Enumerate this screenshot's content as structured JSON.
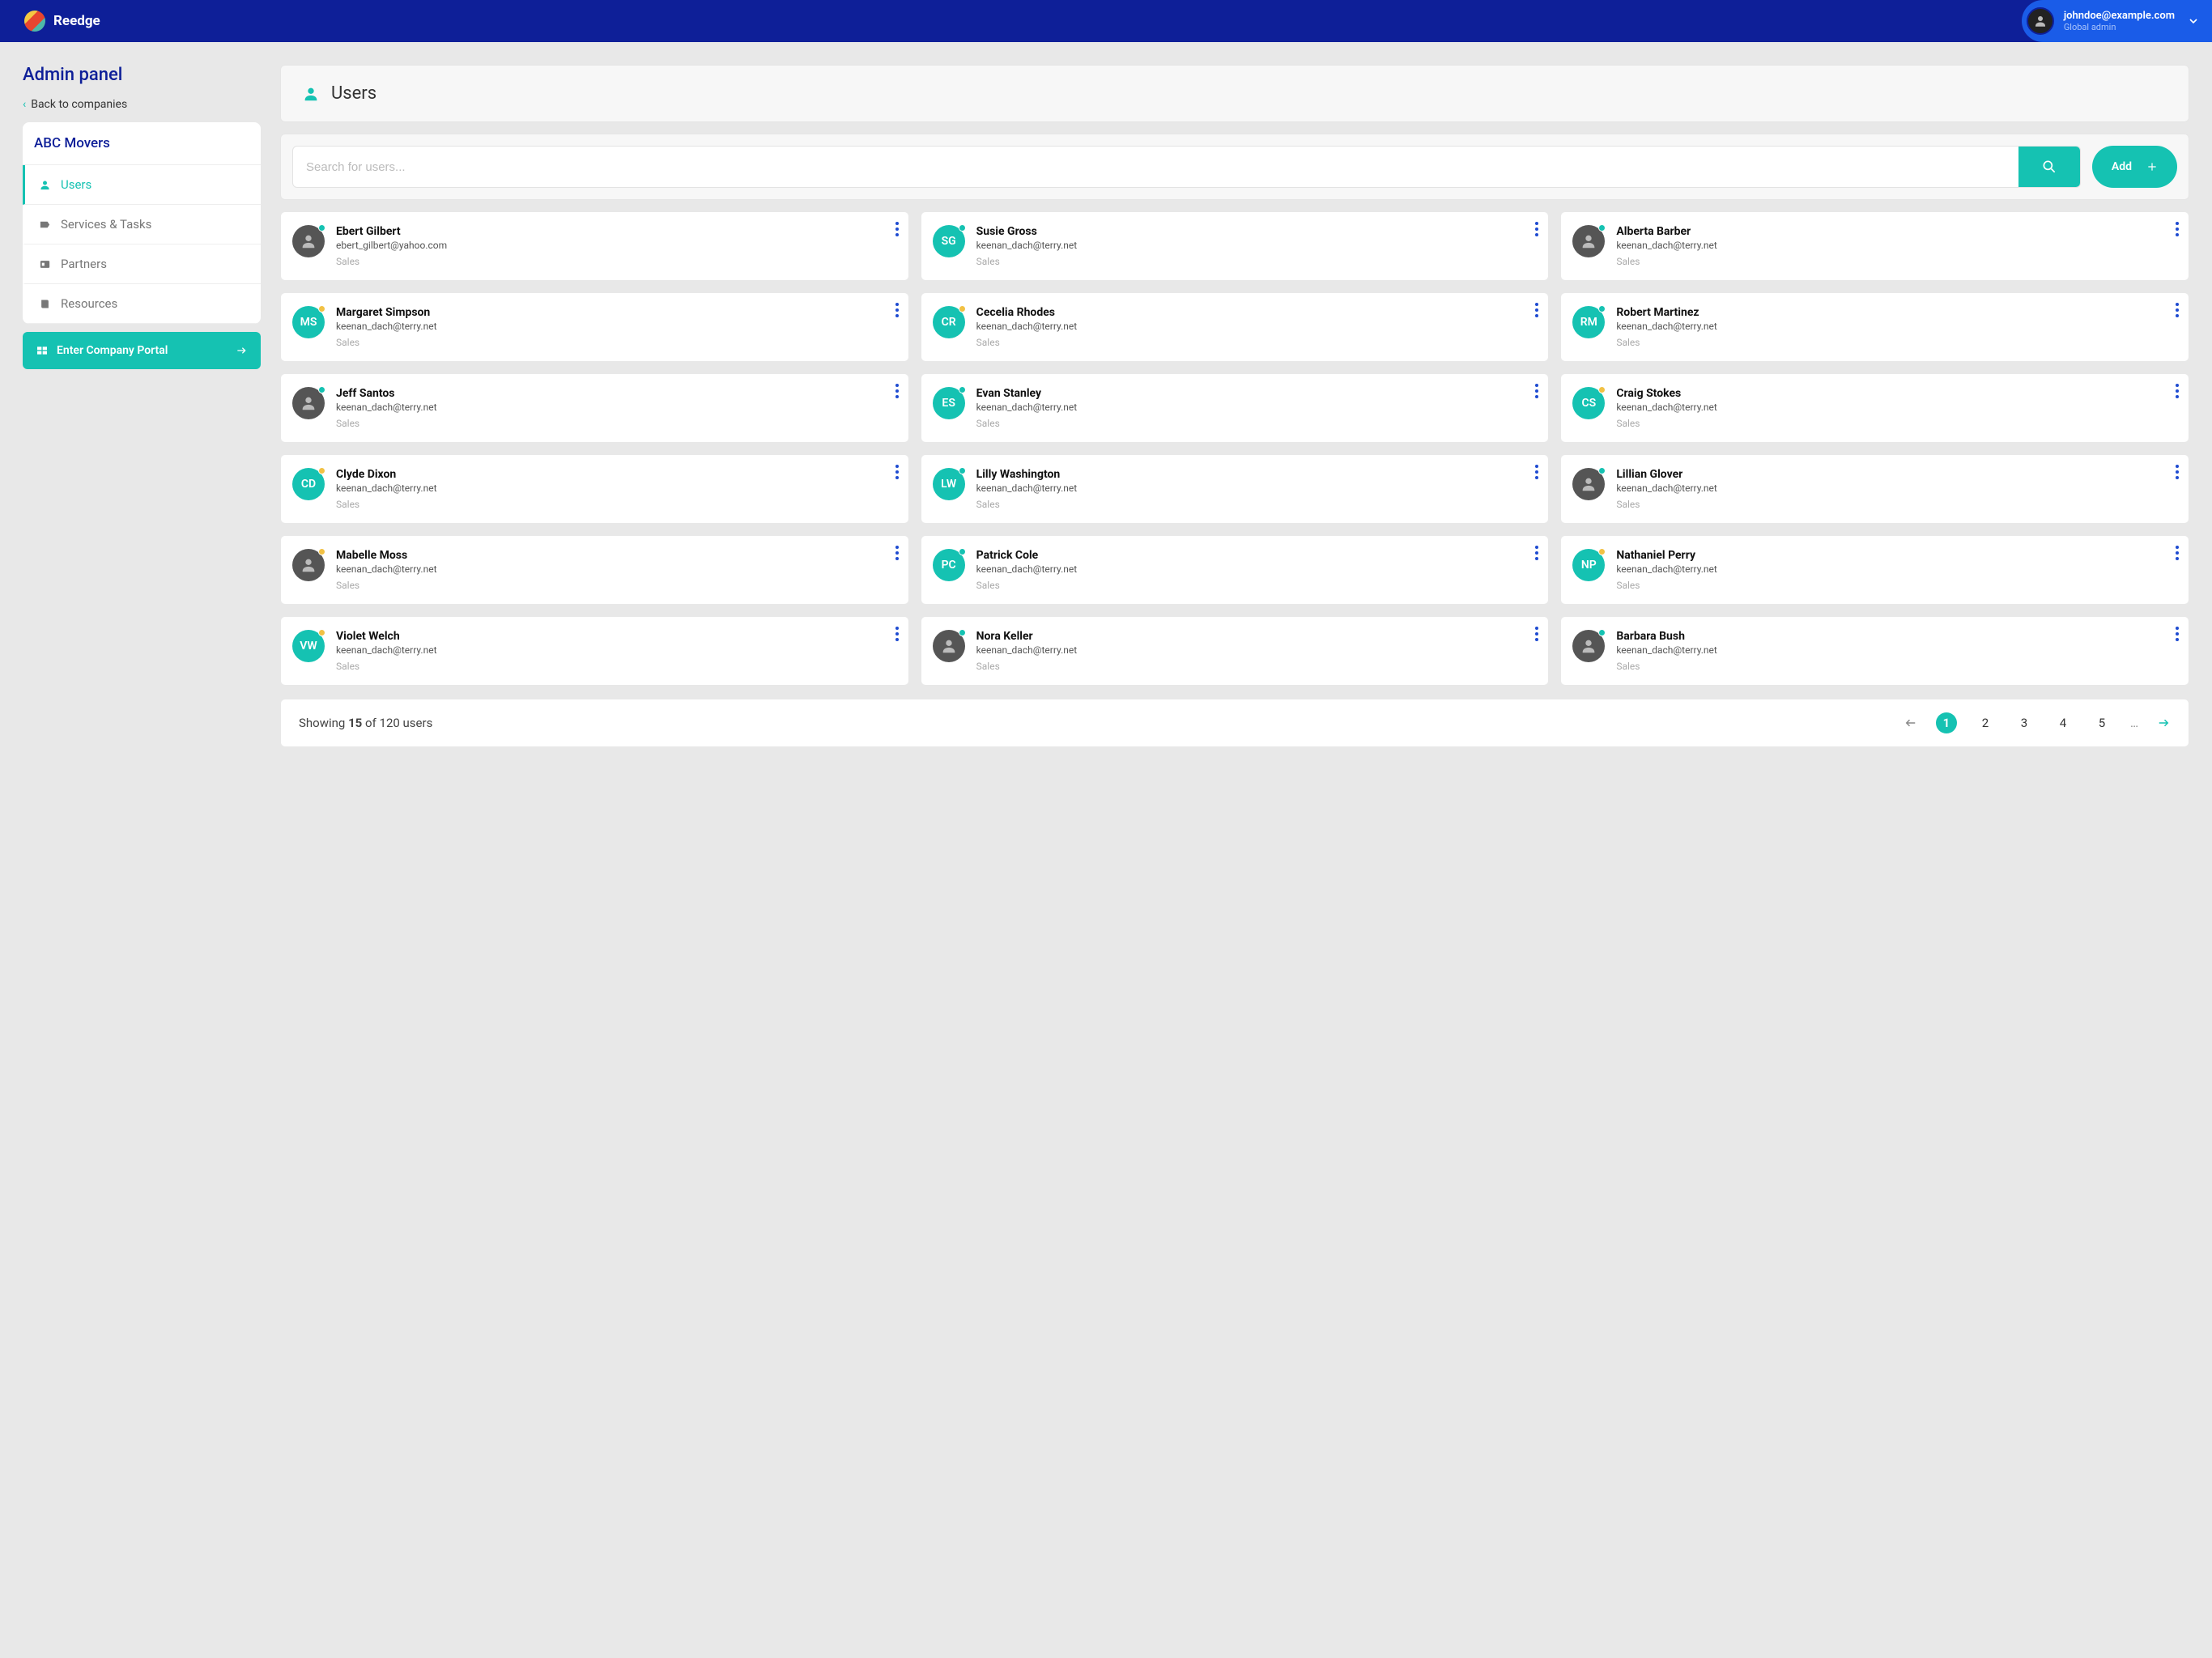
{
  "brand": "Reedge",
  "header": {
    "email": "johndoe@example.com",
    "role": "Global admin"
  },
  "sidebar": {
    "panel_title": "Admin panel",
    "back_label": "Back to companies",
    "company": "ABC Movers",
    "items": [
      {
        "label": "Users",
        "icon": "user",
        "active": true
      },
      {
        "label": "Services & Tasks",
        "icon": "tag"
      },
      {
        "label": "Partners",
        "icon": "id"
      },
      {
        "label": "Resources",
        "icon": "book"
      }
    ],
    "portal_label": "Enter Company Portal"
  },
  "page": {
    "title": "Users",
    "search_placeholder": "Search for users...",
    "add_label": "Add"
  },
  "users": [
    {
      "name": "Ebert Gilbert",
      "email": "ebert_gilbert@yahoo.com",
      "role": "Sales",
      "avatar": "photo",
      "status": "online"
    },
    {
      "name": "Susie Gross",
      "email": "keenan_dach@terry.net",
      "role": "Sales",
      "avatar": "SG",
      "status": "online"
    },
    {
      "name": "Alberta Barber",
      "email": "keenan_dach@terry.net",
      "role": "Sales",
      "avatar": "photo",
      "status": "online"
    },
    {
      "name": "Margaret Simpson",
      "email": "keenan_dach@terry.net",
      "role": "Sales",
      "avatar": "MS",
      "status": "away"
    },
    {
      "name": "Cecelia Rhodes",
      "email": "keenan_dach@terry.net",
      "role": "Sales",
      "avatar": "CR",
      "status": "away"
    },
    {
      "name": "Robert Martinez",
      "email": "keenan_dach@terry.net",
      "role": "Sales",
      "avatar": "RM",
      "status": "online"
    },
    {
      "name": "Jeff Santos",
      "email": "keenan_dach@terry.net",
      "role": "Sales",
      "avatar": "photo",
      "status": "online"
    },
    {
      "name": "Evan Stanley",
      "email": "keenan_dach@terry.net",
      "role": "Sales",
      "avatar": "ES",
      "status": "online"
    },
    {
      "name": "Craig Stokes",
      "email": "keenan_dach@terry.net",
      "role": "Sales",
      "avatar": "CS",
      "status": "away"
    },
    {
      "name": "Clyde Dixon",
      "email": "keenan_dach@terry.net",
      "role": "Sales",
      "avatar": "CD",
      "status": "away"
    },
    {
      "name": "Lilly Washington",
      "email": "keenan_dach@terry.net",
      "role": "Sales",
      "avatar": "LW",
      "status": "online"
    },
    {
      "name": "Lillian Glover",
      "email": "keenan_dach@terry.net",
      "role": "Sales",
      "avatar": "photo",
      "status": "online"
    },
    {
      "name": "Mabelle Moss",
      "email": "keenan_dach@terry.net",
      "role": "Sales",
      "avatar": "photo",
      "status": "away"
    },
    {
      "name": "Patrick Cole",
      "email": "keenan_dach@terry.net",
      "role": "Sales",
      "avatar": "PC",
      "status": "online"
    },
    {
      "name": "Nathaniel Perry",
      "email": "keenan_dach@terry.net",
      "role": "Sales",
      "avatar": "NP",
      "status": "away"
    },
    {
      "name": "Violet Welch",
      "email": "keenan_dach@terry.net",
      "role": "Sales",
      "avatar": "VW",
      "status": "away"
    },
    {
      "name": "Nora Keller",
      "email": "keenan_dach@terry.net",
      "role": "Sales",
      "avatar": "photo",
      "status": "online"
    },
    {
      "name": "Barbara Bush",
      "email": "keenan_dach@terry.net",
      "role": "Sales",
      "avatar": "photo",
      "status": "online"
    }
  ],
  "pagination": {
    "showing_prefix": "Showing ",
    "showing_count": "15",
    "showing_mid": " of 120 users",
    "pages": [
      "1",
      "2",
      "3",
      "4",
      "5"
    ],
    "ellipsis": "…"
  },
  "colors": {
    "accent": "#15c2b2",
    "brand": "#0e1f98"
  }
}
